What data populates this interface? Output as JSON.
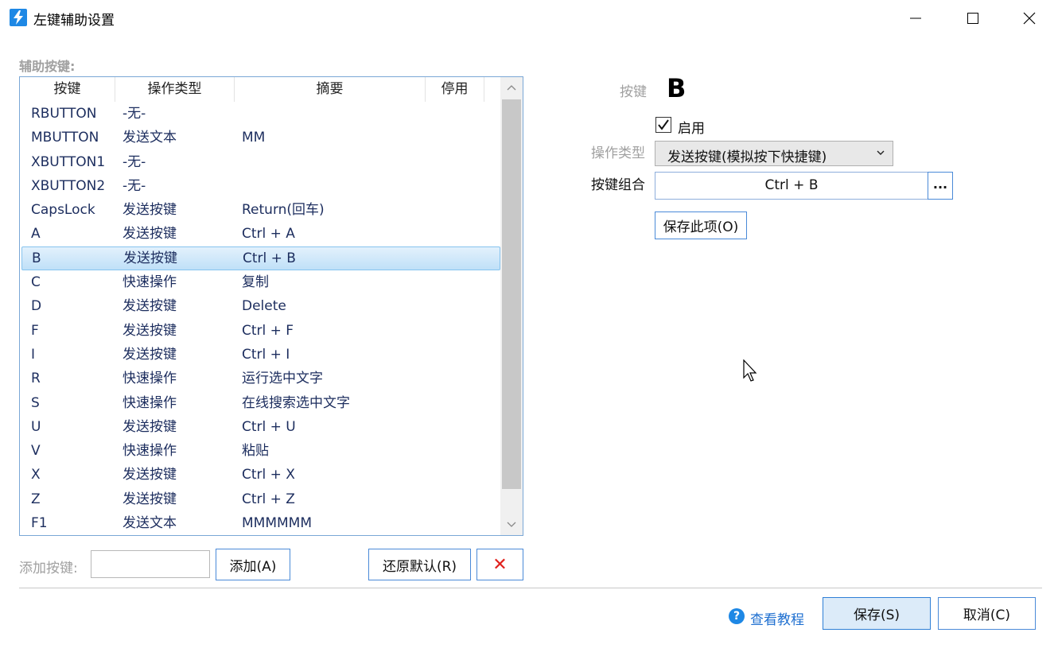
{
  "window": {
    "title": "左键辅助设置"
  },
  "section_label": "辅助按键:",
  "list": {
    "columns": [
      "按键",
      "操作类型",
      "摘要",
      "停用"
    ],
    "rows": [
      {
        "key": "RBUTTON",
        "type": "-无-",
        "summary": ""
      },
      {
        "key": "MBUTTON",
        "type": "发送文本",
        "summary": "MM"
      },
      {
        "key": "XBUTTON1",
        "type": "-无-",
        "summary": ""
      },
      {
        "key": "XBUTTON2",
        "type": "-无-",
        "summary": ""
      },
      {
        "key": "CapsLock",
        "type": "发送按键",
        "summary": "Return(回车)"
      },
      {
        "key": "A",
        "type": "发送按键",
        "summary": "Ctrl + A"
      },
      {
        "key": "B",
        "type": "发送按键",
        "summary": "Ctrl + B",
        "selected": true
      },
      {
        "key": "C",
        "type": "快速操作",
        "summary": "复制"
      },
      {
        "key": "D",
        "type": "发送按键",
        "summary": "Delete"
      },
      {
        "key": "F",
        "type": "发送按键",
        "summary": "Ctrl + F"
      },
      {
        "key": "I",
        "type": "发送按键",
        "summary": "Ctrl + I"
      },
      {
        "key": "R",
        "type": "快速操作",
        "summary": "运行选中文字"
      },
      {
        "key": "S",
        "type": "快速操作",
        "summary": "在线搜索选中文字"
      },
      {
        "key": "U",
        "type": "发送按键",
        "summary": "Ctrl + U"
      },
      {
        "key": "V",
        "type": "快速操作",
        "summary": "粘贴"
      },
      {
        "key": "X",
        "type": "发送按键",
        "summary": "Ctrl + X"
      },
      {
        "key": "Z",
        "type": "发送按键",
        "summary": "Ctrl + Z"
      },
      {
        "key": "F1",
        "type": "发送文本",
        "summary": "MMMMMM"
      }
    ]
  },
  "add_row": {
    "label": "添加按键:",
    "input_value": "",
    "add_button": "添加(A)",
    "restore_button": "还原默认(R)",
    "delete_button": "✕"
  },
  "detail": {
    "key_label": "按键",
    "key_value": "B",
    "enabled": true,
    "enable_label": "启用",
    "optype_label": "操作类型",
    "optype_value": "发送按键(模拟按下快捷键)",
    "combo_label": "按键组合",
    "combo_value": "Ctrl + B",
    "combo_browse": "...",
    "save_item_button": "保存此项(O)"
  },
  "footer": {
    "help_icon": "?",
    "help_text": "查看教程",
    "save_button": "保存(S)",
    "cancel_button": "取消(C)"
  },
  "colors": {
    "accent": "#1e88e5",
    "selection": "#bfe0f8",
    "delete": "#e0201c"
  }
}
